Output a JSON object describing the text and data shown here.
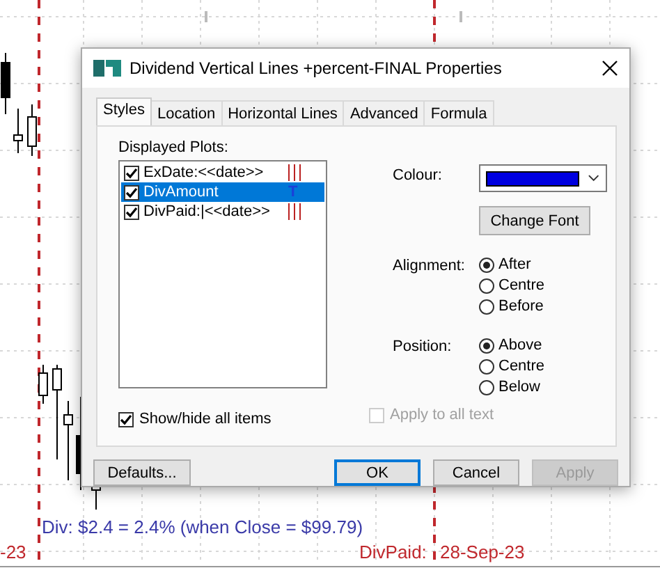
{
  "chart": {
    "labels": [
      {
        "text": "Div: $2.4 = 2.4% (when Close = $99.79)",
        "color": "#3a3aa8"
      },
      {
        "text": "-23",
        "color": "#c0282d"
      },
      {
        "text": "DivPaid:",
        "color": "#c0282d"
      },
      {
        "text": "28-Sep-23",
        "color": "#c0282d"
      }
    ]
  },
  "window": {
    "title": "Dividend Vertical Lines +percent-FINAL Properties"
  },
  "tabs": [
    {
      "label": "Styles",
      "selected": true
    },
    {
      "label": "Location",
      "selected": false
    },
    {
      "label": "Horizontal Lines",
      "selected": false
    },
    {
      "label": "Advanced",
      "selected": false
    },
    {
      "label": "Formula",
      "selected": false
    }
  ],
  "plots": {
    "label": "Displayed Plots:",
    "items": [
      {
        "label": "ExDate:<<date>>",
        "checked": true,
        "selected": false,
        "kind": "lines"
      },
      {
        "label": "DivAmount",
        "checked": true,
        "selected": true,
        "kind": "text",
        "preview": "T"
      },
      {
        "label": "DivPaid:|<<date>>",
        "checked": true,
        "selected": false,
        "kind": "lines"
      }
    ]
  },
  "show_hide": {
    "label": "Show/hide all items",
    "checked": true
  },
  "colour": {
    "label": "Colour:",
    "color": "#0000e0"
  },
  "change_font": "Change Font",
  "alignment": {
    "label": "Alignment:",
    "options": [
      {
        "label": "After",
        "selected": true
      },
      {
        "label": "Centre",
        "selected": false
      },
      {
        "label": "Before",
        "selected": false
      }
    ]
  },
  "position": {
    "label": "Position:",
    "options": [
      {
        "label": "Above",
        "selected": true
      },
      {
        "label": "Centre",
        "selected": false
      },
      {
        "label": "Below",
        "selected": false
      }
    ]
  },
  "apply_all": {
    "label": "Apply to all text",
    "checked": false,
    "disabled": true
  },
  "buttons": [
    {
      "label": "Defaults...",
      "default": false,
      "disabled": false
    },
    {
      "label": "OK",
      "default": true,
      "disabled": false
    },
    {
      "label": "Cancel",
      "default": false,
      "disabled": false
    },
    {
      "label": "Apply",
      "default": false,
      "disabled": true
    }
  ]
}
